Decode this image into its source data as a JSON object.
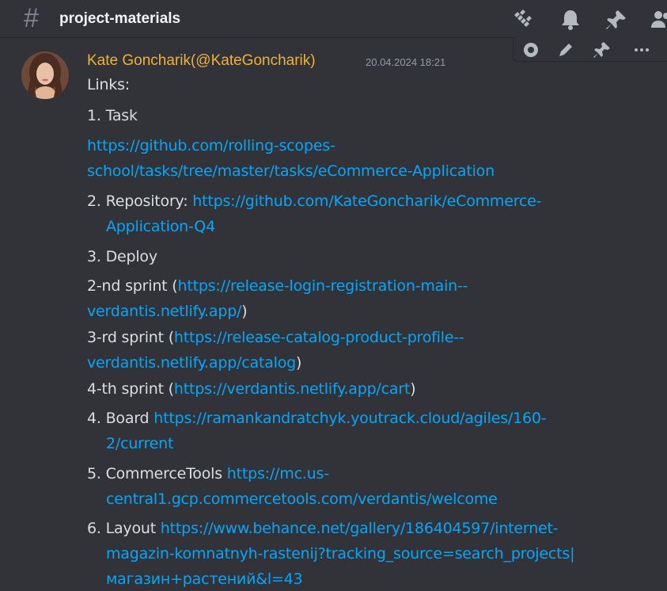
{
  "header": {
    "hash": "#",
    "channel": "project-materials",
    "icons": [
      "threads-icon",
      "bell-icon",
      "pin-icon",
      "members-icon"
    ]
  },
  "hover_actions": [
    "add-reaction-icon",
    "edit-icon",
    "pin-icon",
    "more-icon"
  ],
  "message": {
    "author": "Kate Goncharik(@KateGoncharik)",
    "timestamp": "20.04.2024 18:21",
    "lines": {
      "links_title": "Links:",
      "task_label": "1. Task",
      "task_url_1": "https://github.com/rolling-scopes-",
      "task_url_2": "school/tasks/tree/master/tasks/eCommerce-Application",
      "repo_label": "2. Repository: ",
      "repo_url_1": "https://github.com/KateGoncharik/eCommerce-",
      "repo_url_2": "Application-Q4",
      "deploy_label": "3. Deploy",
      "sprint2_pre": "2-nd sprint (",
      "sprint2_url_1": "https://release-login-registration-main--",
      "sprint2_url_2": "verdantis.netlify.app/",
      "sprint2_post": ")",
      "sprint3_pre": "3-rd sprint (",
      "sprint3_url_1": "https://release-catalog-product-profile--",
      "sprint3_url_2": "verdantis.netlify.app/catalog",
      "sprint3_post": ")",
      "sprint4_pre": "4-th sprint (",
      "sprint4_url": "https://verdantis.netlify.app/cart",
      "sprint4_post": ")",
      "board_label": "4. Board ",
      "board_url_1": "https://ramankandratchyk.youtrack.cloud/agiles/160-",
      "board_url_2": "2/current",
      "ct_label": "5. CommerceTools ",
      "ct_url_1": "https://mc.us-",
      "ct_url_2": "central1.gcp.commercetools.com/verdantis/welcome",
      "layout_label": "6. Layout ",
      "layout_url_1": "https://www.behance.net/gallery/186404597/internet-",
      "layout_url_2": "magazin-komnatnyh-rastenij?tracking_source=search_projects|",
      "layout_url_3": "магазин+растений&l=43"
    }
  },
  "colors": {
    "background": "#313338",
    "author": "#f0b232",
    "link": "#00a8fc",
    "text": "#dbdee1",
    "muted": "#949ba4"
  }
}
